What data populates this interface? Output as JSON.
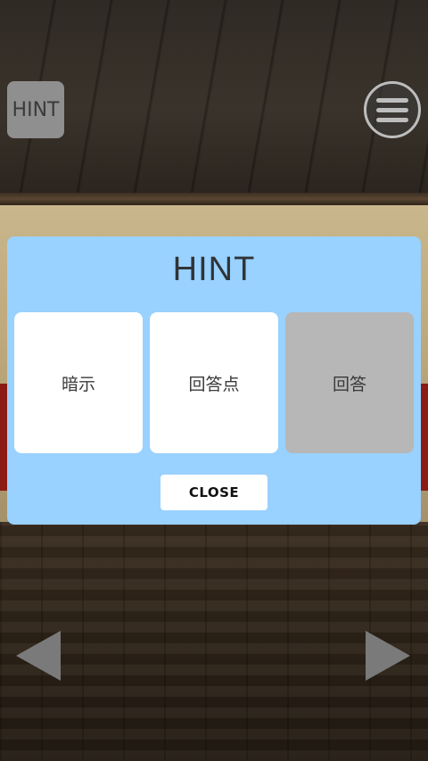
{
  "hud": {
    "hint_label": "HINT",
    "menu_icon": "hamburger-menu-icon",
    "prev_icon": "arrow-left-icon",
    "next_icon": "arrow-right-icon"
  },
  "dialog": {
    "title": "HINT",
    "options": [
      {
        "label": "暗示",
        "enabled": true
      },
      {
        "label": "回答点",
        "enabled": true
      },
      {
        "label": "回答",
        "enabled": false
      }
    ],
    "close_label": "CLOSE"
  },
  "colors": {
    "dialog_bg": "#99d1ff",
    "option_bg": "#ffffff",
    "option_disabled_bg": "#b7b7b7",
    "hud_button_bg": "#8f8f8f"
  }
}
